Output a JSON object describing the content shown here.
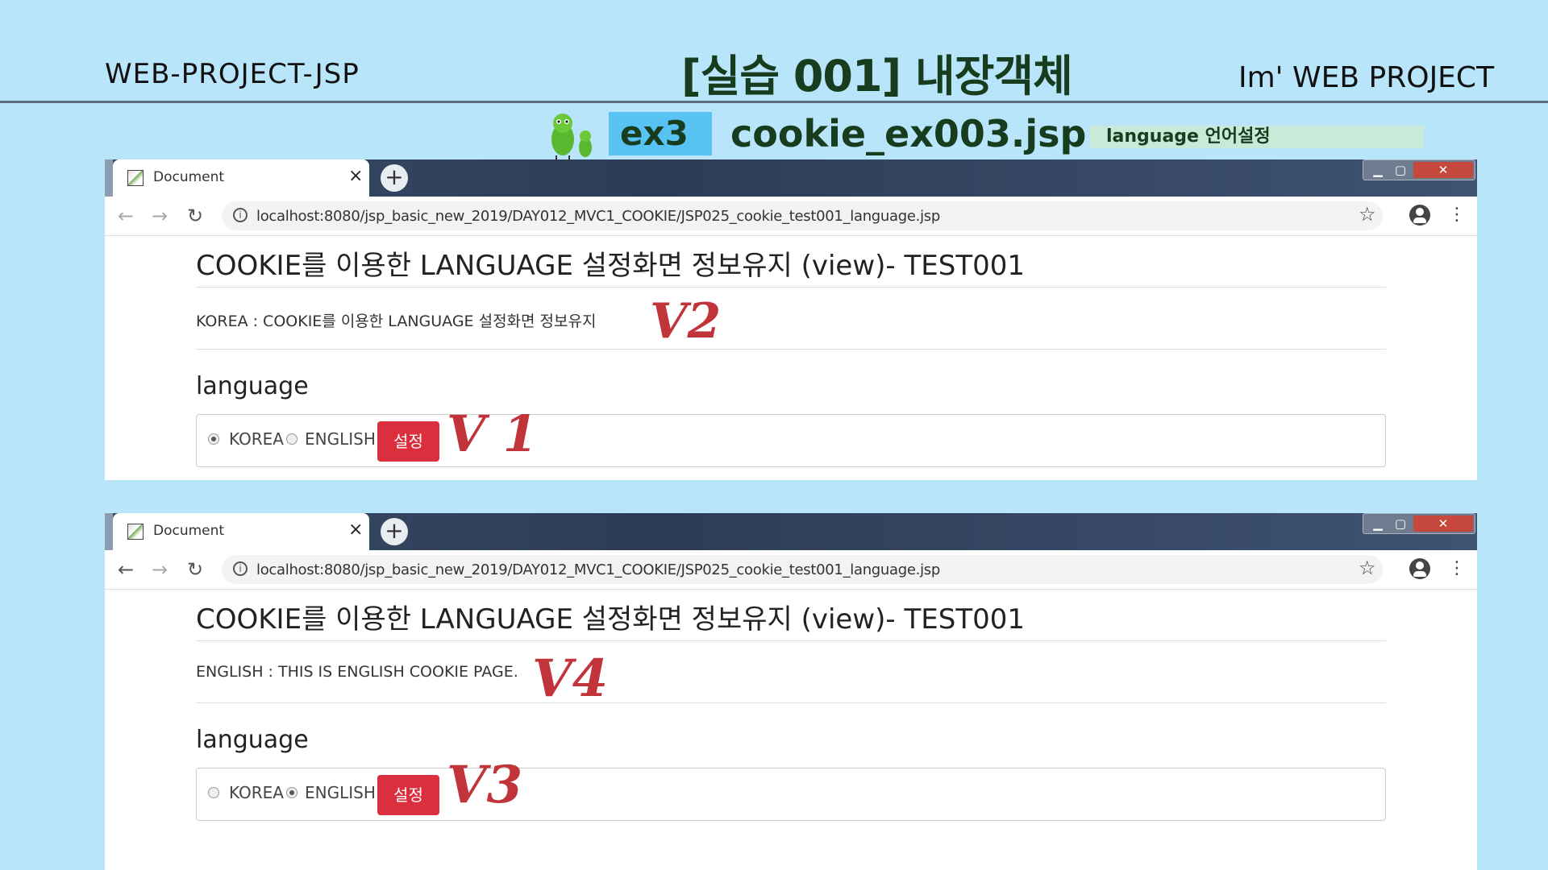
{
  "header": {
    "left_text": "WEB-PROJECT-JSP",
    "title": "[실습 001] 내장객체",
    "right_text": "Im' WEB PROJECT"
  },
  "subheader": {
    "badge": "ex3",
    "file": "cookie_ex003.jsp",
    "label": "language 언어설정"
  },
  "colors": {
    "background": "#b9e5fb",
    "badge": "#58c3f2",
    "title_text": "#173d1e",
    "button": "#dc2f3e",
    "mark": "#c0343a"
  },
  "browsers": [
    {
      "tab_title": "Document",
      "url": "localhost:8080/jsp_basic_new_2019/DAY012_MVC1_COOKIE/JSP025_cookie_test001_language.jsp",
      "heading": "COOKIE를 이용한 LANGUAGE 설정화면 정보유지 (view)- TEST001",
      "info": "KOREA : COOKIE를 이용한 LANGUAGE 설정화면 정보유지",
      "section_label": "language",
      "options": [
        {
          "label": "KOREA",
          "checked": true
        },
        {
          "label": "ENGLISH",
          "checked": false
        }
      ],
      "submit_label": "설정",
      "annotations": {
        "info_mark": "V2",
        "form_mark": "V 1"
      }
    },
    {
      "tab_title": "Document",
      "url": "localhost:8080/jsp_basic_new_2019/DAY012_MVC1_COOKIE/JSP025_cookie_test001_language.jsp",
      "heading": "COOKIE를 이용한 LANGUAGE 설정화면 정보유지 (view)- TEST001",
      "info": "ENGLISH : THIS IS ENGLISH COOKIE PAGE.",
      "section_label": "language",
      "options": [
        {
          "label": "KOREA",
          "checked": false
        },
        {
          "label": "ENGLISH",
          "checked": true
        }
      ],
      "submit_label": "설정",
      "annotations": {
        "info_mark": "V4",
        "form_mark": "V3"
      }
    }
  ],
  "icons": {
    "back": "arrow-left-icon",
    "forward": "arrow-right-icon",
    "reload": "reload-icon",
    "info": "info-icon",
    "bookmark": "star-icon",
    "account": "account-icon",
    "menu": "kebab-menu-icon",
    "tab_close": "close-icon",
    "new_tab": "plus-icon"
  }
}
